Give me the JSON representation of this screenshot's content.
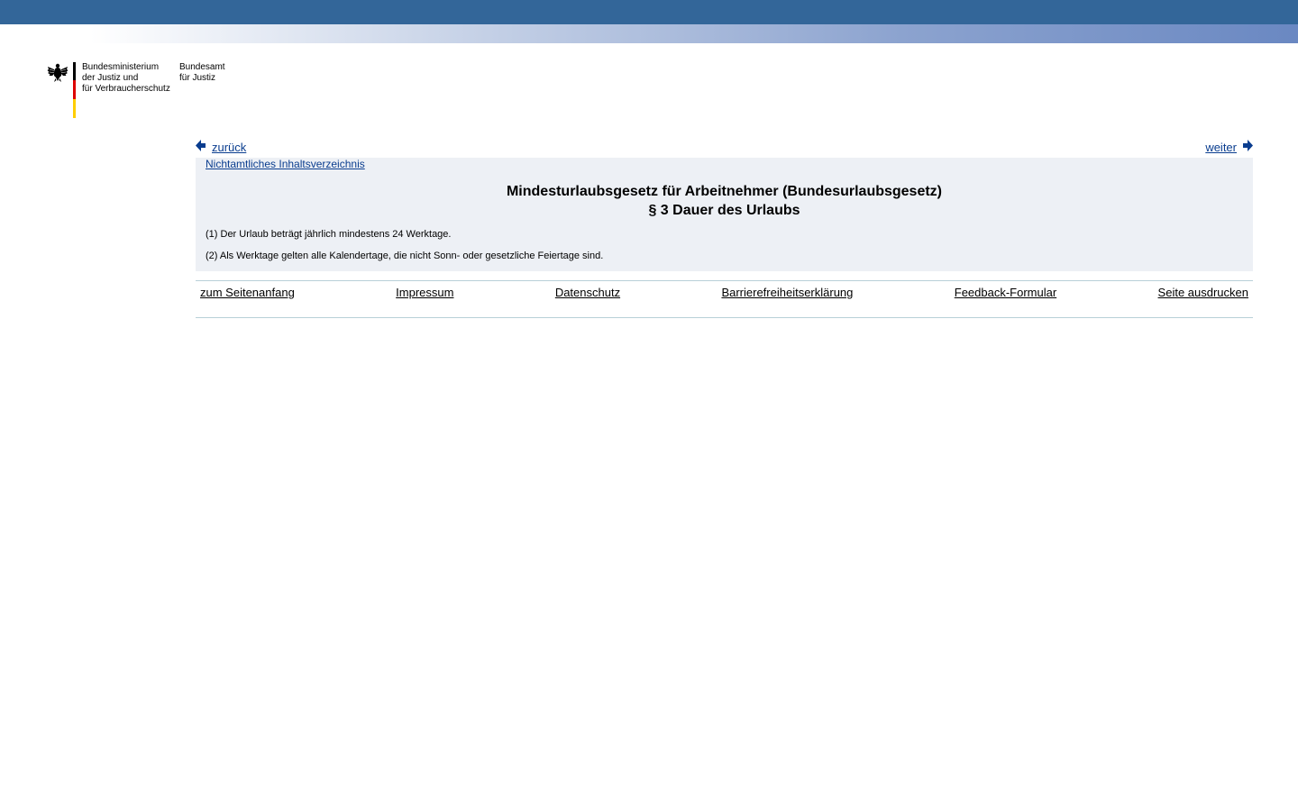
{
  "header": {
    "ministry_lines": [
      "Bundesministerium",
      "der Justiz und",
      "für Verbraucherschutz"
    ],
    "office_lines": [
      "Bundesamt",
      "für Justiz"
    ],
    "eagle_icon": "federal-eagle-icon",
    "colors": {
      "top_bar": "#336699",
      "flag_black": "#000000",
      "flag_red": "#dd0000",
      "flag_gold": "#ffce00"
    }
  },
  "nav": {
    "back_label": "zurück",
    "forward_label": "weiter",
    "back_icon": "arrow-left-icon",
    "forward_icon": "arrow-right-icon",
    "link_color": "#0a3d8f"
  },
  "content": {
    "toc_label": "Nichtamtliches Inhaltsverzeichnis",
    "title_line1": "Mindesturlaubsgesetz für Arbeitnehmer (Bundesurlaubsgesetz)",
    "title_line2": "§ 3 Dauer des Urlaubs",
    "paragraphs": [
      "(1) Der Urlaub beträgt jährlich mindestens 24 Werktage.",
      "(2) Als Werktage gelten alle Kalendertage, die nicht Sonn- oder gesetzliche Feiertage sind."
    ],
    "box_background": "#edf0f5"
  },
  "footer": {
    "links": [
      "zum Seitenanfang",
      "Impressum",
      "Datenschutz",
      "Barrierefreiheitserklärung",
      "Feedback-Formular",
      "Seite ausdrucken"
    ]
  }
}
